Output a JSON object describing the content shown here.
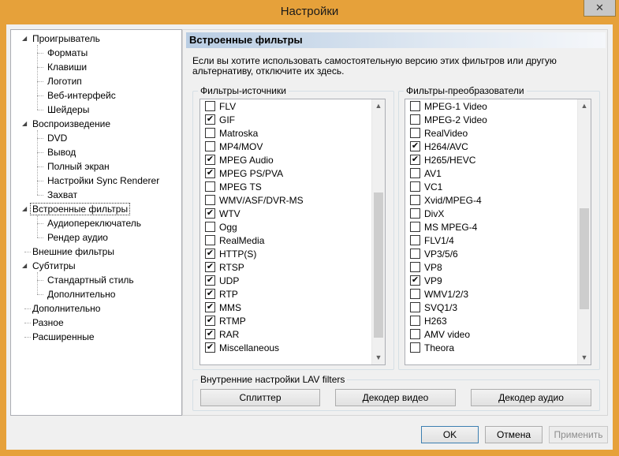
{
  "window": {
    "title": "Настройки",
    "close_glyph": "✕"
  },
  "tree": {
    "items": [
      {
        "label": "Проигрыватель",
        "level": 0,
        "expanded": true
      },
      {
        "label": "Форматы",
        "level": 1
      },
      {
        "label": "Клавиши",
        "level": 1
      },
      {
        "label": "Логотип",
        "level": 1
      },
      {
        "label": "Веб-интерфейс",
        "level": 1
      },
      {
        "label": "Шейдеры",
        "level": 1
      },
      {
        "label": "Воспроизведение",
        "level": 0,
        "expanded": true
      },
      {
        "label": "DVD",
        "level": 1
      },
      {
        "label": "Вывод",
        "level": 1
      },
      {
        "label": "Полный экран",
        "level": 1
      },
      {
        "label": "Настройки Sync Renderer",
        "level": 1
      },
      {
        "label": "Захват",
        "level": 1
      },
      {
        "label": "Встроенные фильтры",
        "level": 0,
        "expanded": true,
        "selected": true
      },
      {
        "label": "Аудиопереключатель",
        "level": 1
      },
      {
        "label": "Рендер аудио",
        "level": 1
      },
      {
        "label": "Внешние фильтры",
        "level": 0
      },
      {
        "label": "Субтитры",
        "level": 0,
        "expanded": true
      },
      {
        "label": "Стандартный стиль",
        "level": 1
      },
      {
        "label": "Дополнительно",
        "level": 1
      },
      {
        "label": "Дополнительно",
        "level": 0
      },
      {
        "label": "Разное",
        "level": 0
      },
      {
        "label": "Расширенные",
        "level": 0
      }
    ]
  },
  "panel": {
    "header": "Встроенные фильтры",
    "description": "Если вы хотите использовать самостоятельную версию этих фильтров или другую альтернативу, отключите их здесь."
  },
  "source_filters": {
    "title": "Фильтры-источники",
    "items": [
      {
        "label": "FLV",
        "checked": false
      },
      {
        "label": "GIF",
        "checked": true
      },
      {
        "label": "Matroska",
        "checked": false
      },
      {
        "label": "MP4/MOV",
        "checked": false
      },
      {
        "label": "MPEG Audio",
        "checked": true
      },
      {
        "label": "MPEG PS/PVA",
        "checked": true
      },
      {
        "label": "MPEG TS",
        "checked": false
      },
      {
        "label": "WMV/ASF/DVR-MS",
        "checked": false
      },
      {
        "label": "WTV",
        "checked": true
      },
      {
        "label": "Ogg",
        "checked": false
      },
      {
        "label": "RealMedia",
        "checked": false
      },
      {
        "label": "HTTP(S)",
        "checked": true
      },
      {
        "label": "RTSP",
        "checked": true
      },
      {
        "label": "UDP",
        "checked": true
      },
      {
        "label": "RTP",
        "checked": true
      },
      {
        "label": "MMS",
        "checked": true
      },
      {
        "label": "RTMP",
        "checked": true
      },
      {
        "label": "RAR",
        "checked": true
      },
      {
        "label": "Miscellaneous",
        "checked": true
      }
    ]
  },
  "transform_filters": {
    "title": "Фильтры-преобразователи",
    "items": [
      {
        "label": "MPEG-1 Video",
        "checked": false
      },
      {
        "label": "MPEG-2 Video",
        "checked": false
      },
      {
        "label": "RealVideo",
        "checked": false
      },
      {
        "label": "H264/AVC",
        "checked": true
      },
      {
        "label": "H265/HEVC",
        "checked": true
      },
      {
        "label": "AV1",
        "checked": false
      },
      {
        "label": "VC1",
        "checked": false
      },
      {
        "label": "Xvid/MPEG-4",
        "checked": false
      },
      {
        "label": "DivX",
        "checked": false
      },
      {
        "label": "MS MPEG-4",
        "checked": false
      },
      {
        "label": "FLV1/4",
        "checked": false
      },
      {
        "label": "VP3/5/6",
        "checked": false
      },
      {
        "label": "VP8",
        "checked": false
      },
      {
        "label": "VP9",
        "checked": true
      },
      {
        "label": "WMV1/2/3",
        "checked": false
      },
      {
        "label": "SVQ1/3",
        "checked": false
      },
      {
        "label": "H263",
        "checked": false
      },
      {
        "label": "AMV video",
        "checked": false
      },
      {
        "label": "Theora",
        "checked": false
      }
    ]
  },
  "lav": {
    "title": "Внутренние настройки LAV filters",
    "splitter_label": "Сплиттер",
    "video_decoder_label": "Декодер видео",
    "audio_decoder_label": "Декодер аудио"
  },
  "footer": {
    "ok_label": "OK",
    "cancel_label": "Отмена",
    "apply_label": "Применить"
  },
  "icons": {
    "expand_arrow": "◢",
    "checkmark": "✔",
    "scroll_up": "▲",
    "scroll_down": "▼"
  },
  "colors": {
    "title_bar": "#e6a13a",
    "client_bg": "#f0f0f0",
    "default_button_border": "#3c7fb1"
  }
}
